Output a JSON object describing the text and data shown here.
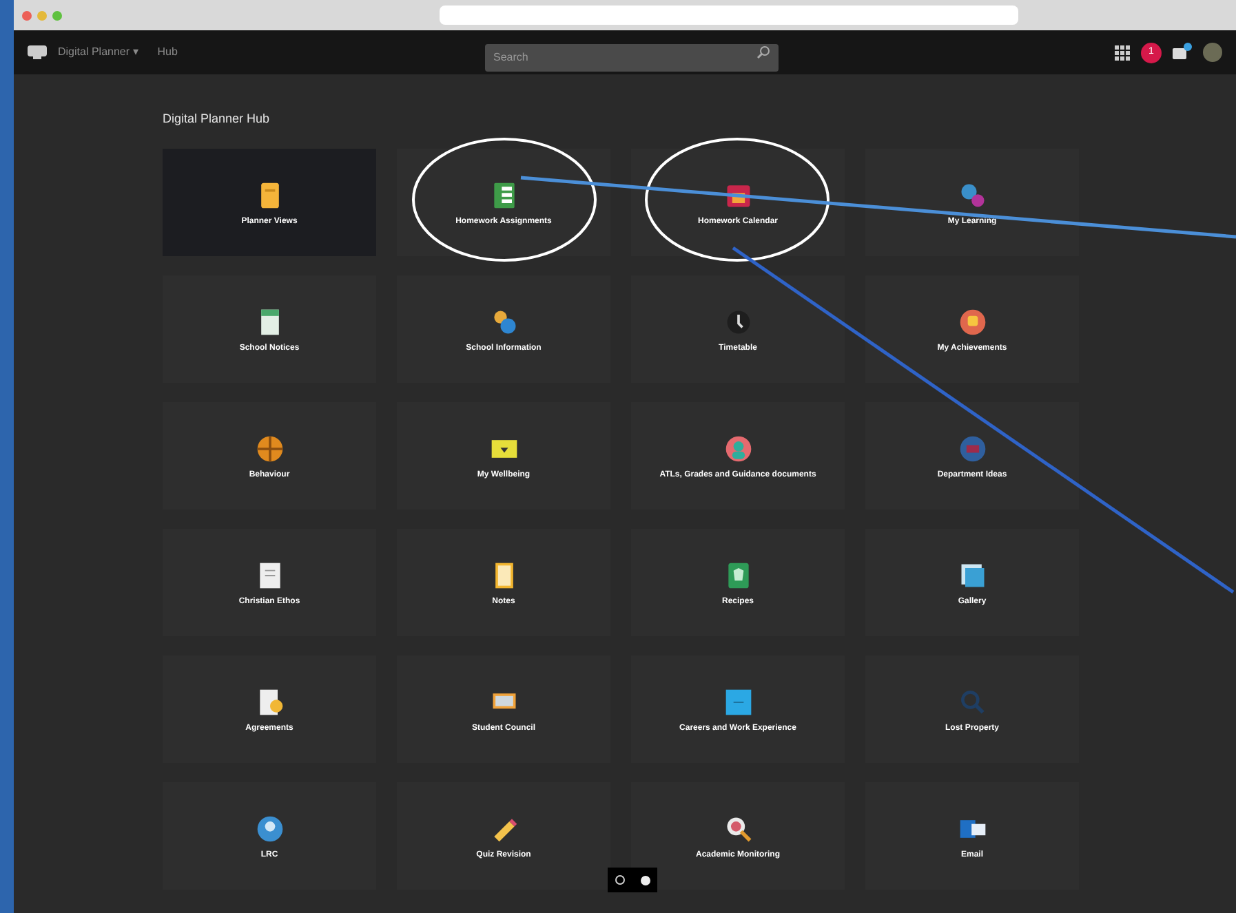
{
  "app_bar": {
    "menu": "Digital Planner ▾",
    "link": "Hub",
    "search": {
      "placeholder": "Search"
    },
    "notification_count": "1"
  },
  "page": {
    "title": "Digital Planner Hub"
  },
  "tiles": [
    {
      "label": "Planner Views",
      "selected": true
    },
    {
      "label": "Homework Assignments",
      "selected": false
    },
    {
      "label": "Homework Calendar",
      "selected": false
    },
    {
      "label": "My Learning",
      "selected": false
    },
    {
      "label": "School Notices",
      "selected": false
    },
    {
      "label": "School Information",
      "selected": false
    },
    {
      "label": "Timetable",
      "selected": false
    },
    {
      "label": "My Achievements",
      "selected": false
    },
    {
      "label": "Behaviour",
      "selected": false
    },
    {
      "label": "My Wellbeing",
      "selected": false
    },
    {
      "label": "ATLs, Grades and Guidance documents",
      "selected": false
    },
    {
      "label": "Department Ideas",
      "selected": false
    },
    {
      "label": "Christian Ethos",
      "selected": false
    },
    {
      "label": "Notes",
      "selected": false
    },
    {
      "label": "Recipes",
      "selected": false
    },
    {
      "label": "Gallery",
      "selected": false
    },
    {
      "label": "Agreements",
      "selected": false
    },
    {
      "label": "Student Council",
      "selected": false
    },
    {
      "label": "Careers and Work Experience",
      "selected": false
    },
    {
      "label": "Lost Property",
      "selected": false
    },
    {
      "label": "LRC",
      "selected": false
    },
    {
      "label": "Quiz Revision",
      "selected": false
    },
    {
      "label": "Academic Monitoring",
      "selected": false
    },
    {
      "label": "Email",
      "selected": false
    }
  ]
}
